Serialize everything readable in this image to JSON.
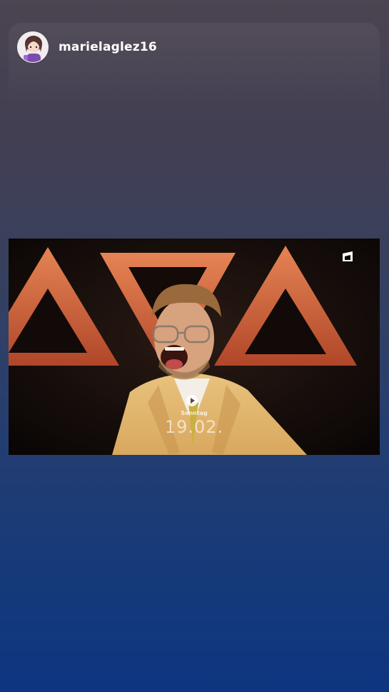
{
  "story": {
    "username": "marielaglez16"
  },
  "video": {
    "watermark_day": "Sonntag",
    "watermark_date": "19.02."
  },
  "icons": {
    "avatar": "avatar",
    "play": "play-icon",
    "channel_logo": "channel-logo-icon"
  },
  "colors": {
    "gradient_top": "#4b4451",
    "gradient_bottom": "#0e3680",
    "triangle_orange": "#d9653a"
  }
}
